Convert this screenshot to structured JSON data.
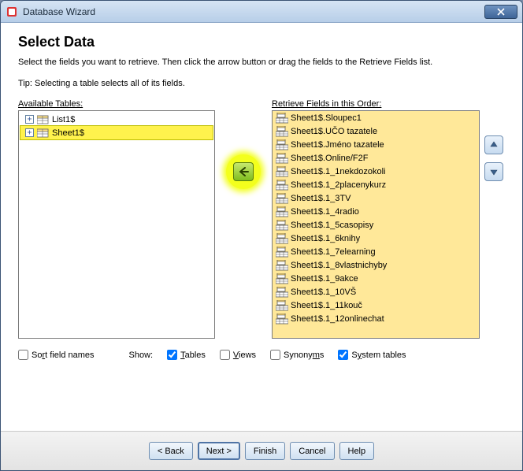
{
  "window": {
    "title": "Database Wizard"
  },
  "page": {
    "heading": "Select Data",
    "description": "Select the fields you want to retrieve. Then click the arrow button or drag the fields to the Retrieve Fields list.",
    "tip": "Tip: Selecting a table selects all of its fields."
  },
  "labels": {
    "available_tables": "Available Tables:",
    "retrieve_fields": "Retrieve Fields in this Order:",
    "show": "Show:"
  },
  "available_tables": [
    {
      "label": "List1$",
      "expanded": false,
      "selected": false
    },
    {
      "label": "Sheet1$",
      "expanded": false,
      "selected": true
    }
  ],
  "retrieve_fields": [
    "Sheet1$.Sloupec1",
    "Sheet1$.UČO tazatele",
    "Sheet1$.Jméno tazatele",
    "Sheet1$.Online/F2F",
    "Sheet1$.1_1nekdozokoli",
    "Sheet1$.1_2placenykurz",
    "Sheet1$.1_3TV",
    "Sheet1$.1_4radio",
    "Sheet1$.1_5casopisy",
    "Sheet1$.1_6knihy",
    "Sheet1$.1_7elearning",
    "Sheet1$.1_8vlastnichyby",
    "Sheet1$.1_9akce",
    "Sheet1$.1_10VŠ",
    "Sheet1$.1_11kouč",
    "Sheet1$.1_12onlinechat"
  ],
  "options": {
    "sort_field_names": {
      "label": "Sort field names",
      "checked": false
    },
    "tables": {
      "label": "Tables",
      "checked": true
    },
    "views": {
      "label": "Views",
      "checked": false
    },
    "synonyms": {
      "label": "Synonyms",
      "checked": false
    },
    "system_tables": {
      "label": "System tables",
      "checked": true
    }
  },
  "buttons": {
    "back": "< Back",
    "next": "Next >",
    "finish": "Finish",
    "cancel": "Cancel",
    "help": "Help"
  }
}
